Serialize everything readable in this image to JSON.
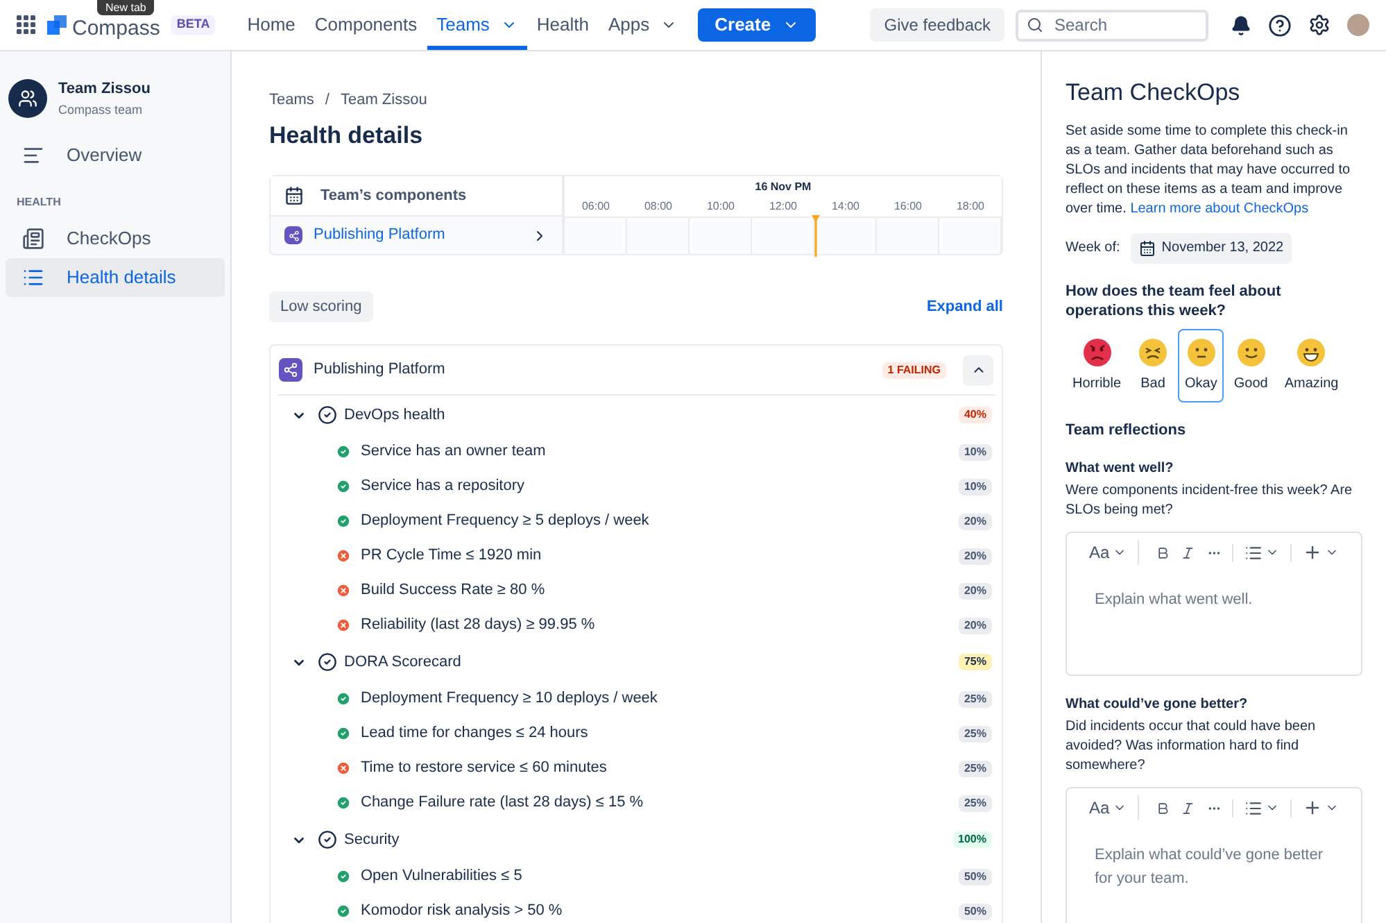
{
  "tooltip": "New tab",
  "topbar": {
    "logo": "Compass",
    "beta": "BETA",
    "nav": [
      {
        "label": "Home",
        "selected": false,
        "dropdown": false
      },
      {
        "label": "Components",
        "selected": false,
        "dropdown": false
      },
      {
        "label": "Teams",
        "selected": true,
        "dropdown": true
      },
      {
        "label": "Health",
        "selected": false,
        "dropdown": false
      },
      {
        "label": "Apps",
        "selected": false,
        "dropdown": true
      }
    ],
    "create": "Create",
    "feedback": "Give feedback",
    "search": {
      "placeholder": "Search"
    }
  },
  "sidebar": {
    "team": "Team Zissou",
    "subtitle": "Compass team",
    "items": [
      {
        "label": "Overview",
        "selected": false,
        "kind": "overview"
      }
    ],
    "section": "HEALTH",
    "health_items": [
      {
        "label": "CheckOps",
        "selected": false,
        "kind": "checkops"
      },
      {
        "label": "Health details",
        "selected": true,
        "kind": "list"
      }
    ]
  },
  "breadcrumbs": [
    "Teams",
    "/",
    "Team Zissou"
  ],
  "title": "Health details",
  "timeline": {
    "header": "Team’s components",
    "date": "16 Nov PM",
    "ticks": [
      "06:00",
      "08:00",
      "10:00",
      "12:00",
      "14:00",
      "16:00",
      "18:00"
    ],
    "component": "Publishing Platform"
  },
  "filter": "Low scoring",
  "expand_all": "Expand all",
  "component": {
    "name": "Publishing Platform",
    "failing": "1 FAILING",
    "groups": [
      {
        "name": "DevOps health",
        "score": "40%",
        "kind": "danger",
        "expanded": true,
        "checks": [
          {
            "label": "Service has an owner team",
            "passed": true,
            "weight": "10%"
          },
          {
            "label": "Service has a repository",
            "passed": true,
            "weight": "10%"
          },
          {
            "label": "Deployment Frequency ≥ 5 deploys / week",
            "passed": true,
            "weight": "20%"
          },
          {
            "label": "PR Cycle Time ≤ 1920 min",
            "passed": false,
            "weight": "20%"
          },
          {
            "label": "Build Success Rate ≥ 80 %",
            "passed": false,
            "weight": "20%"
          },
          {
            "label": "Reliability (last 28 days) ≥ 99.95 %",
            "passed": false,
            "weight": "20%"
          }
        ]
      },
      {
        "name": "DORA Scorecard",
        "score": "75%",
        "kind": "warning",
        "expanded": true,
        "checks": [
          {
            "label": "Deployment Frequency ≥ 10 deploys / week",
            "passed": true,
            "weight": "25%"
          },
          {
            "label": "Lead time for changes ≤ 24 hours",
            "passed": true,
            "weight": "25%"
          },
          {
            "label": "Time to restore service ≤ 60 minutes",
            "passed": false,
            "weight": "25%"
          },
          {
            "label": "Change Failure rate (last 28 days) ≤ 15 %",
            "passed": true,
            "weight": "25%"
          }
        ]
      },
      {
        "name": "Security",
        "score": "100%",
        "kind": "success",
        "expanded": true,
        "checks": [
          {
            "label": "Open Vulnerabilities ≤ 5",
            "passed": true,
            "weight": "50%"
          },
          {
            "label": "Komodor risk analysis > 50 %",
            "passed": true,
            "weight": "50%"
          }
        ]
      }
    ]
  },
  "checkops": {
    "title": "Team CheckOps",
    "intro": "Set aside some time to complete this check-in as a team. Gather data beforehand such as SLOs and incidents that may have occurred to reflect on these items as a team and improve over time.",
    "learn_more": "Learn more about CheckOps",
    "week_label": "Week of:",
    "week": "November 13, 2022",
    "question": "How does the team feel about operations this week?",
    "moods": [
      {
        "label": "Horrible",
        "selected": false
      },
      {
        "label": "Bad",
        "selected": false
      },
      {
        "label": "Okay",
        "selected": true
      },
      {
        "label": "Good",
        "selected": false
      },
      {
        "label": "Amazing",
        "selected": false
      }
    ],
    "reflections": "Team reflections",
    "prompts": [
      {
        "title": "What went well?",
        "hint": "Were components incident-free this week? Are SLOs being met?",
        "placeholder": "Explain what went well.",
        "text_style": "Aa"
      },
      {
        "title": "What could’ve gone better?",
        "hint": "Did incidents occur that could have been avoided? Was information hard to find somewhere?",
        "placeholder": "Explain what could’ve gone better for your team.",
        "text_style": "Aa"
      }
    ]
  }
}
